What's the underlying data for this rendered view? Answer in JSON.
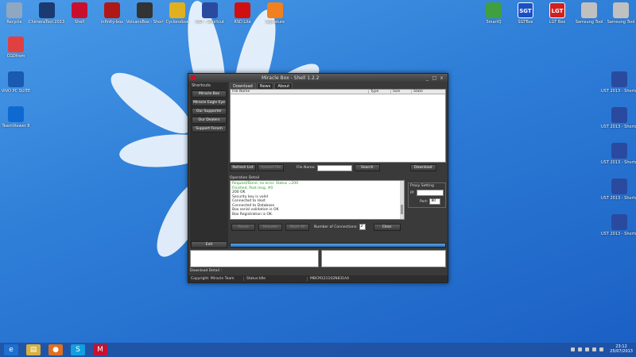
{
  "desktop_left_icons": [
    {
      "label": "Recycle",
      "icon": "recycle-bin-icon",
      "color": "#8fa7c0"
    },
    {
      "label": "ChimeraTool 2013 - Shortcut",
      "icon": "chimera-icon",
      "color": "#1c3a70"
    },
    {
      "label": "Shell",
      "icon": "shell-icon",
      "color": "#c8102e"
    },
    {
      "label": "infinity-box",
      "icon": "infinity-icon",
      "color": "#b01818"
    },
    {
      "label": "VolcanoBox - Shortcut",
      "icon": "volcano-icon",
      "color": "#333333"
    },
    {
      "label": "Cyclonebox",
      "icon": "cyclone-icon",
      "color": "#e0b020"
    },
    {
      "label": "UST - Shortcut",
      "icon": "ust-icon",
      "color": "#2a4aa0"
    },
    {
      "label": "RSD Lite",
      "icon": "motorola-icon",
      "color": "#d01010"
    },
    {
      "label": "Signature",
      "icon": "signature-icon",
      "color": "#f08020"
    }
  ],
  "desktop_col_icons": [
    {
      "label": "CGDfrom",
      "icon": "cgd-icon",
      "color": "#e04040"
    },
    {
      "label": "VIVO PC SUITE",
      "icon": "vivo-icon",
      "color": "#1a5ab0"
    },
    {
      "label": "TeamViewer 8",
      "icon": "teamviewer-icon",
      "color": "#0e6ad0"
    }
  ],
  "desktop_right_top_icons": [
    {
      "label": "SmartQ",
      "icon": "smartq-icon",
      "color": "#40a040"
    },
    {
      "label": "SGTBox",
      "icon": "sgt-icon",
      "color": "#1a4fc8",
      "text": "SGT"
    },
    {
      "label": "LGT Box",
      "icon": "lgt-icon",
      "color": "#d02020",
      "text": "LGT"
    },
    {
      "label": "Samsung Tool",
      "icon": "gear-icon",
      "color": "#c0c0c0"
    },
    {
      "label": "Samsung Tool",
      "icon": "gear-icon",
      "color": "#c0c0c0"
    }
  ],
  "desktop_right_col_icons": [
    {
      "label": "UST 2013 - Shortcut",
      "icon": "ust-icon",
      "color": "#2a4aa0"
    },
    {
      "label": "UST 2013 - Shortcut",
      "icon": "ust-icon",
      "color": "#2a4aa0"
    },
    {
      "label": "UST 2013 - Shortcut",
      "icon": "ust-icon",
      "color": "#2a4aa0"
    },
    {
      "label": "UST 2013 - Shortcut",
      "icon": "ust-icon",
      "color": "#2a4aa0"
    },
    {
      "label": "UST 2013 - Shortcut",
      "icon": "ust-icon",
      "color": "#2a4aa0"
    }
  ],
  "window": {
    "title": "Miracle Box - Shell 1.2.2",
    "min": "_",
    "max": "□",
    "close": "x",
    "sidebar": {
      "header": "Shortcuts",
      "buttons": [
        "Miracle Box",
        "Miracle Eagle Eye",
        "Our Supporter",
        "Our Dealers",
        "Support Forum"
      ],
      "exit": "Exit"
    },
    "tabs": [
      "Download",
      "News",
      "About"
    ],
    "file_columns": [
      "File Name",
      "Type",
      "Size",
      "State"
    ],
    "refresh": "Refresh List",
    "upload": "Upload File",
    "file_name_label": "File Name:",
    "file_name_value": "",
    "search": "Search",
    "download": "Download",
    "op_header": "Operation Detail",
    "op_log": [
      {
        "text": "Request/Done, no error. Status =200",
        "type": "g"
      },
      {
        "text": "Finished, Post msg, #0",
        "type": "g"
      },
      {
        "text": "200 OK",
        "type": "k"
      },
      {
        "text": "Security key is valid",
        "type": "k"
      },
      {
        "text": "Connected to Host",
        "type": "k"
      },
      {
        "text": "Connected to Database",
        "type": "k"
      },
      {
        "text": "Box serial validation is OK",
        "type": "k"
      },
      {
        "text": "Box Registration is OK.",
        "type": "k"
      }
    ],
    "proxy_header": "Proxy Setting",
    "ip_label": "IP:",
    "ip_value": "",
    "port_label": "Port:",
    "port_value": "80",
    "pause": "Pause",
    "resume": "Resume",
    "abort": "Abort All",
    "conn_label": "Number of Connections:",
    "conn_value": "2",
    "clear": "Clear",
    "download_detail": "Download Detail :",
    "status": [
      "Copyright: Miracle Team",
      "Status:Idle",
      "MBCM121102N831A4"
    ]
  },
  "taskbar": {
    "items": [
      {
        "icon": "ie-icon",
        "glyph": "e",
        "color": "#1f6fd0"
      },
      {
        "icon": "explorer-icon",
        "glyph": "▤",
        "color": "#d8b040"
      },
      {
        "icon": "firefox-icon",
        "glyph": "●",
        "color": "#e07020"
      },
      {
        "icon": "skype-icon",
        "glyph": "S",
        "color": "#10a0e0"
      },
      {
        "icon": "shell-icon",
        "glyph": "M",
        "color": "#c8102e"
      }
    ],
    "time": "23:12",
    "date": "25/07/2013"
  }
}
